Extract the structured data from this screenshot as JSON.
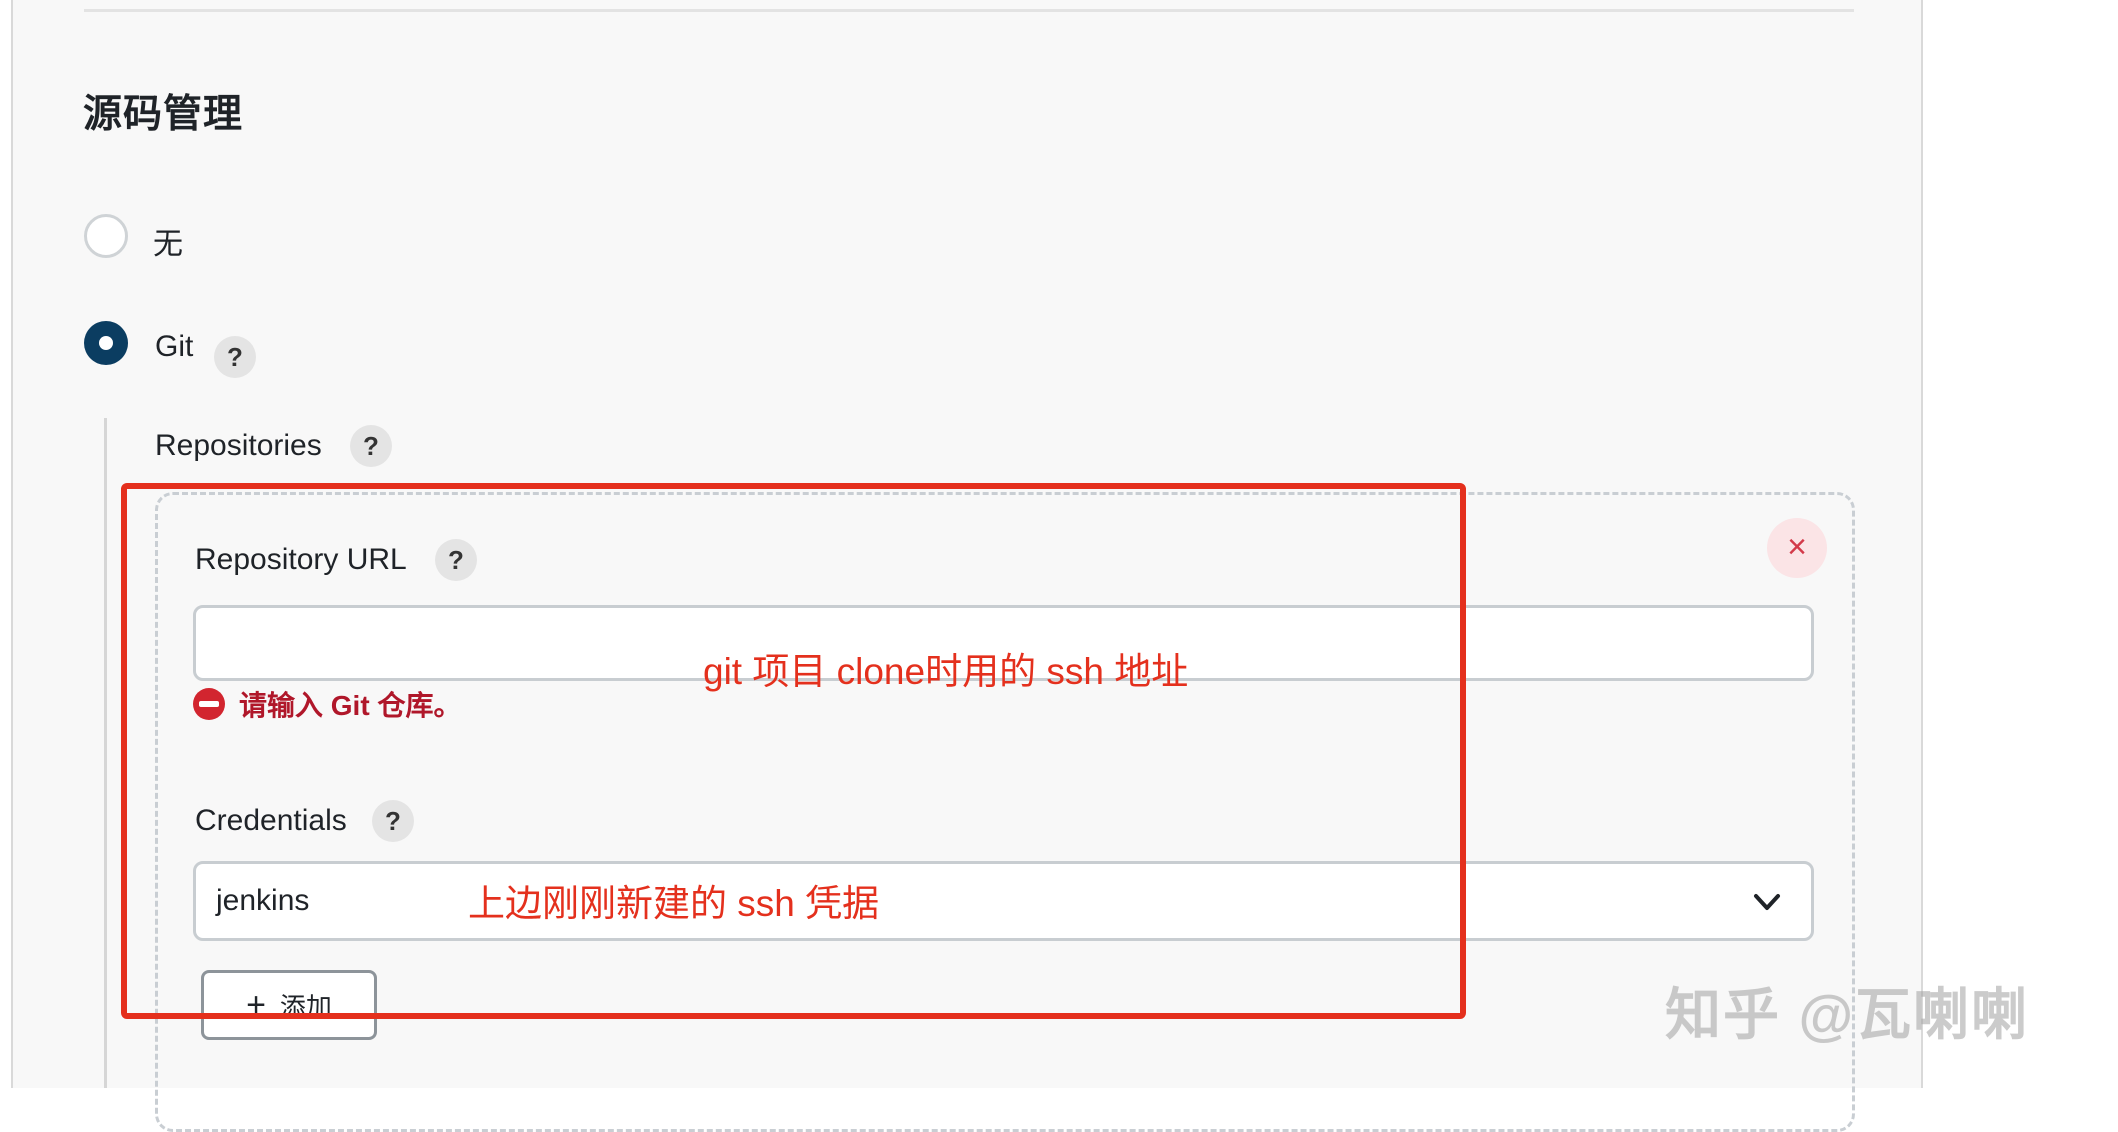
{
  "section": {
    "title": "源码管理"
  },
  "scm_options": [
    {
      "label": "无",
      "selected": false
    },
    {
      "label": "Git",
      "selected": true
    }
  ],
  "help_glyph": "?",
  "repositories": {
    "label": "Repositories",
    "repository_url": {
      "label": "Repository URL",
      "value": "",
      "error": "请输入 Git 仓库。"
    },
    "credentials": {
      "label": "Credentials",
      "selected": "jenkins"
    },
    "add_button": {
      "plus": "+",
      "label": "添加"
    },
    "delete_icon": "×"
  },
  "annotations": {
    "url_note": "git 项目 clone时用的 ssh 地址",
    "credentials_note": "上边刚刚新建的 ssh 凭据",
    "color": "#e4301d"
  },
  "watermark": "知乎 @瓦喇喇",
  "colors": {
    "radio_selected": "#0b3d61",
    "error": "#b0172a",
    "panel_bg": "#f8f8f8"
  }
}
